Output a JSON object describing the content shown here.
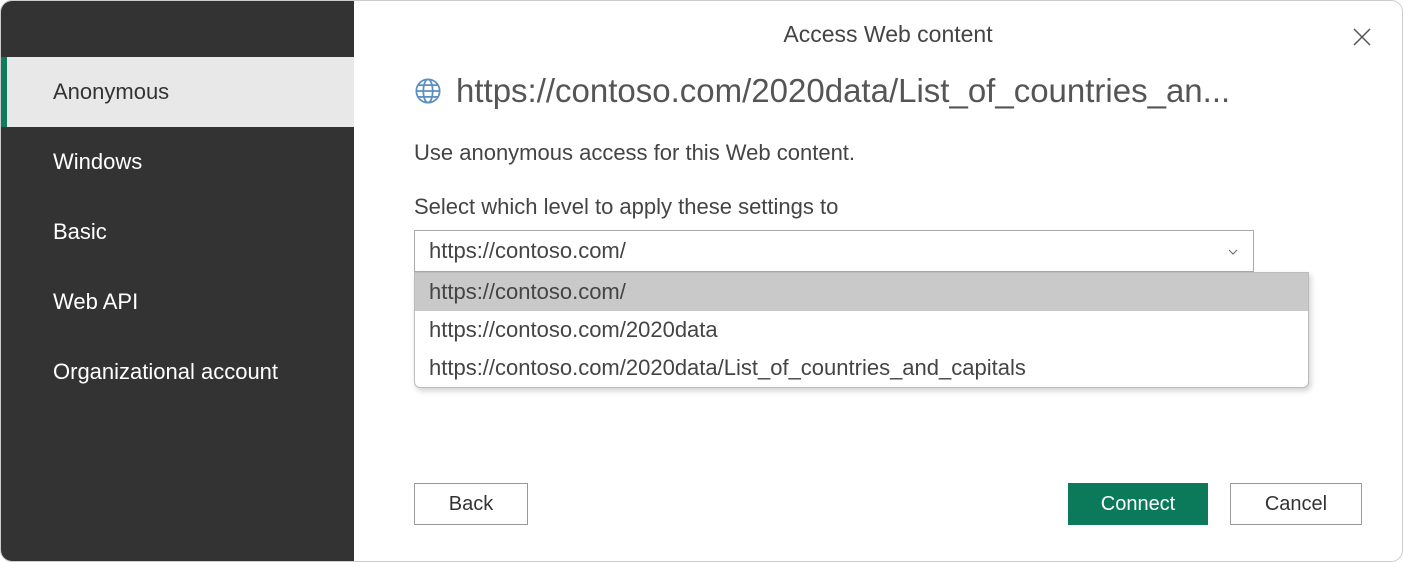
{
  "dialog": {
    "title": "Access Web content"
  },
  "sidebar": {
    "items": [
      {
        "label": "Anonymous",
        "selected": true
      },
      {
        "label": "Windows",
        "selected": false
      },
      {
        "label": "Basic",
        "selected": false
      },
      {
        "label": "Web API",
        "selected": false
      },
      {
        "label": "Organizational account",
        "selected": false
      }
    ]
  },
  "main": {
    "url": "https://contoso.com/2020data/List_of_countries_an...",
    "description": "Use anonymous access for this Web content.",
    "level_label": "Select which level to apply these settings to",
    "dropdown": {
      "selected": "https://contoso.com/",
      "options": [
        "https://contoso.com/",
        "https://contoso.com/2020data",
        "https://contoso.com/2020data/List_of_countries_and_capitals"
      ]
    }
  },
  "buttons": {
    "back": "Back",
    "connect": "Connect",
    "cancel": "Cancel"
  }
}
